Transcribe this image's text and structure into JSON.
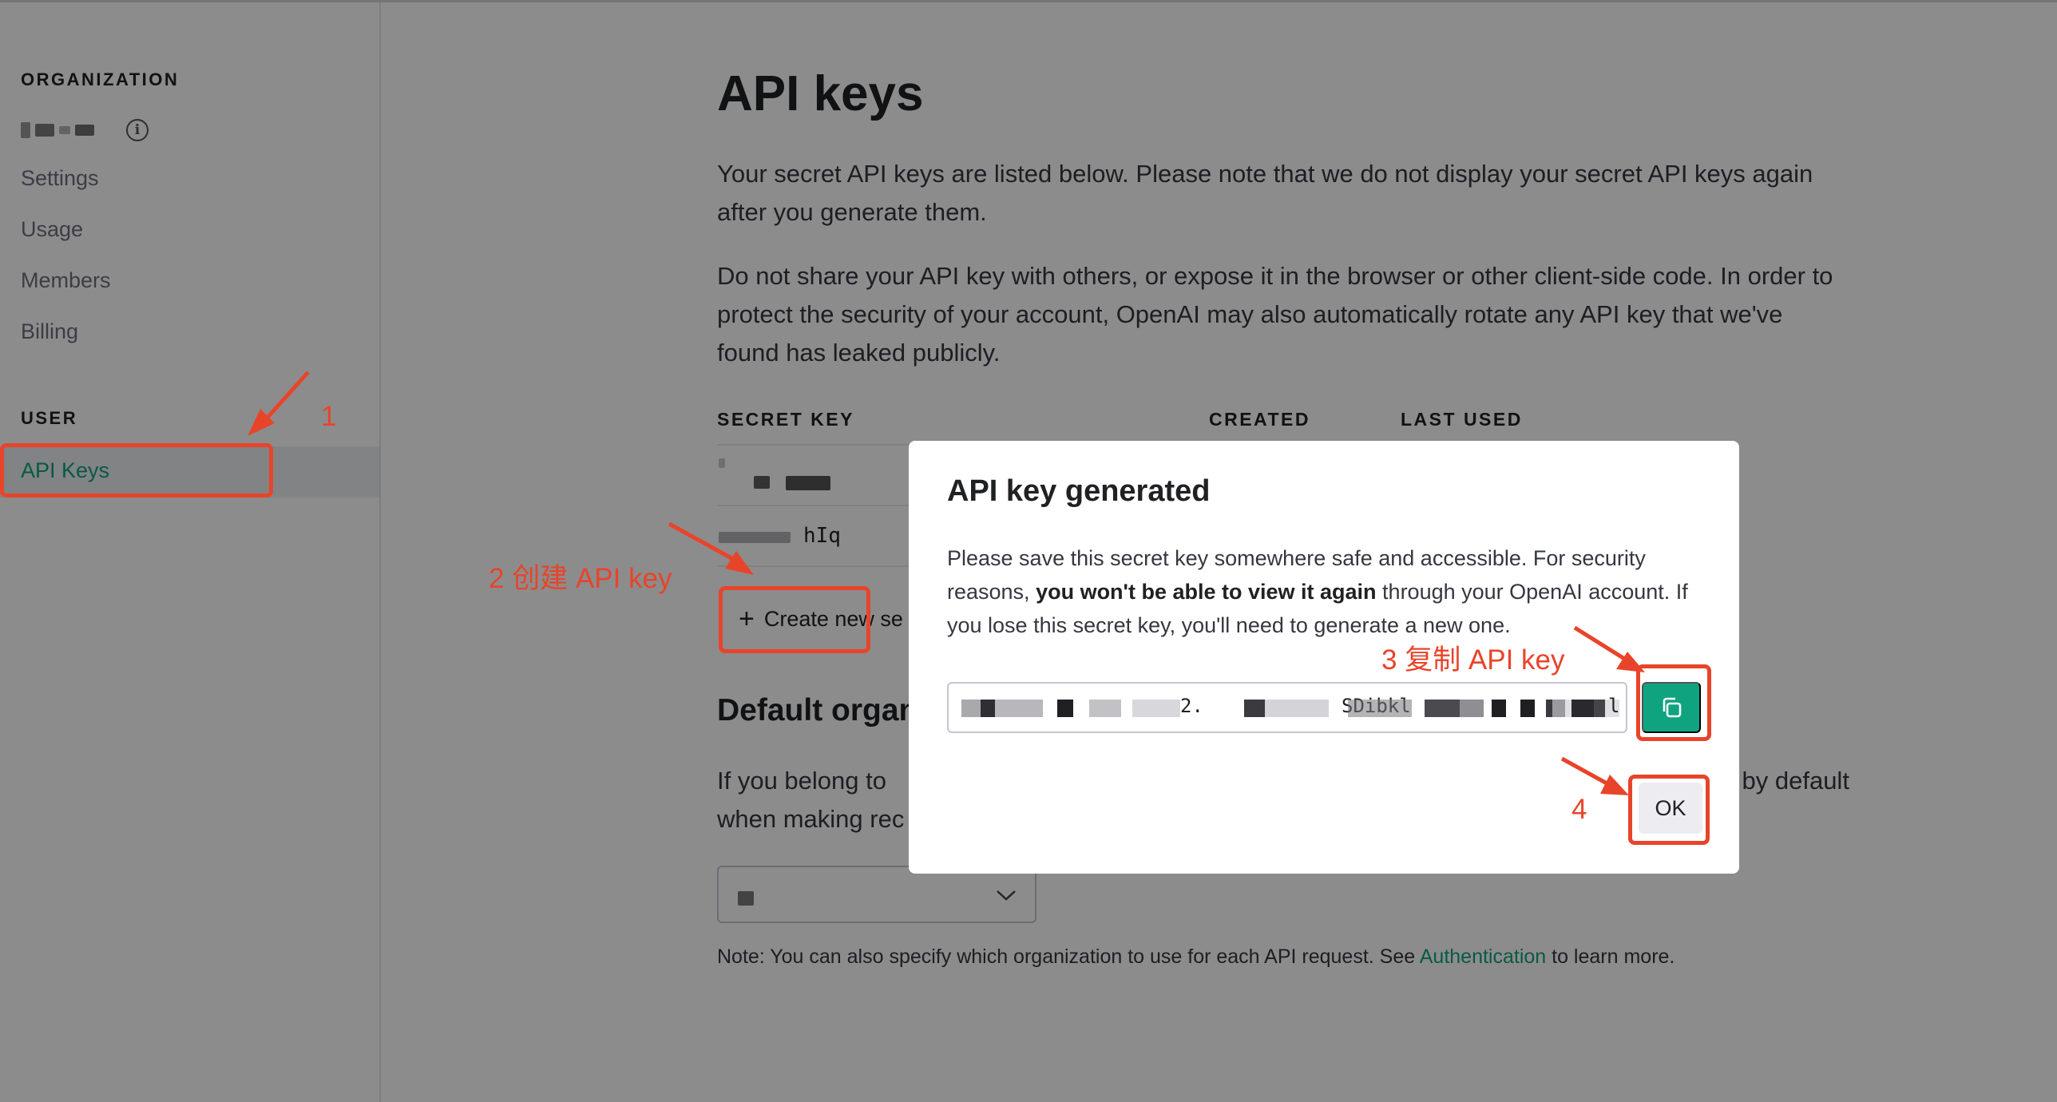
{
  "sidebar": {
    "org_heading": "ORGANIZATION",
    "org_name": "",
    "links": [
      "Settings",
      "Usage",
      "Members",
      "Billing"
    ],
    "user_heading": "USER",
    "active_item": "API Keys"
  },
  "main": {
    "title": "API keys",
    "paragraph1_line1": "Your secret API keys are listed below. Please note that we do not display your secret API keys again",
    "paragraph1_line2": "after you generate them.",
    "paragraph2_line1": "Do not share your API key with others, or expose it in the browser or other client-side code. In order to",
    "paragraph2_line2": "protect the security of your account, OpenAI may also automatically rotate any API key that we've",
    "paragraph2_line3": "found has leaked publicly.",
    "table": {
      "col_secret_key": "SECRET KEY",
      "col_created": "CREATED",
      "col_last_used": "LAST USED",
      "row2_key_suffix": "hIq"
    },
    "create_button": "Create new se",
    "default_org_heading": "Default organ",
    "default_org_line1_start": "If you belong to",
    "default_org_line1_end": "l by default",
    "default_org_line2": "when making rec",
    "note_start": "Note: You can also specify which organization to use for each API request. See ",
    "note_link": "Authentication",
    "note_end": " to learn more."
  },
  "modal": {
    "title": "API key generated",
    "body_start": "Please save this secret key somewhere safe and accessible. For security reasons, ",
    "body_bold": "you won't be able to view it again",
    "body_end": " through your OpenAI account. If you lose this secret key, you'll need to generate a new one.",
    "key_visible_fragments": [
      "2.",
      "SDibkl",
      "l"
    ],
    "ok_button": "OK"
  },
  "annotations": {
    "step1": "1",
    "step2": "2 创建 API key",
    "step3": "3 复制 API key",
    "step4": "4"
  },
  "colors": {
    "accent_green": "#10a37f",
    "annotation_red": "#e8442a"
  },
  "icons": {
    "copy": "copy-icon",
    "info": "info-icon",
    "plus": "plus-icon",
    "chevron": "chevron-down-icon"
  }
}
